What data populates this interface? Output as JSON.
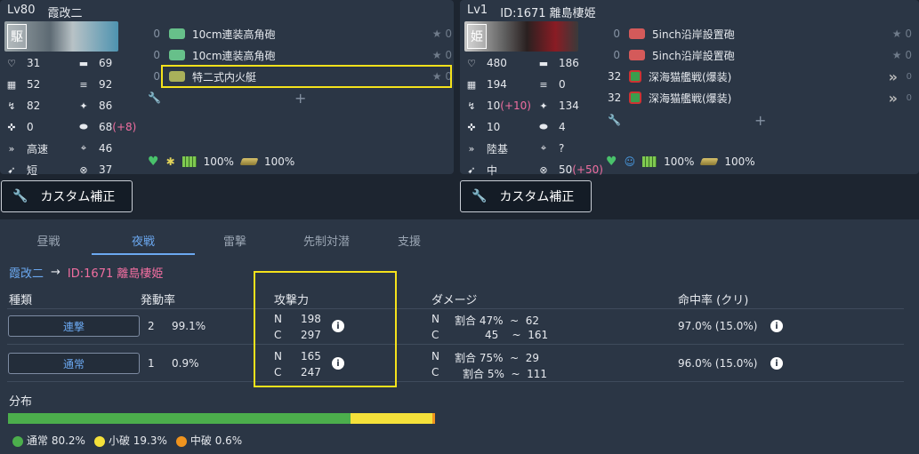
{
  "left_ship": {
    "level": "Lv80",
    "name": "霞改二",
    "banner_tag": "駆",
    "stats": [
      {
        "icon": "hp-icon",
        "glyph": "♡",
        "value": "31"
      },
      {
        "icon": "firepower-icon",
        "glyph": "▬",
        "value": "69"
      },
      {
        "icon": "armor-icon",
        "glyph": "▦",
        "value": "52"
      },
      {
        "icon": "torpedo-icon",
        "glyph": "≡",
        "value": "92"
      },
      {
        "icon": "evasion-icon",
        "glyph": "↯",
        "value": "82"
      },
      {
        "icon": "aa-icon",
        "glyph": "✦",
        "value": "86"
      },
      {
        "icon": "aircraft-icon",
        "glyph": "✜",
        "value": "0"
      },
      {
        "icon": "asw-icon",
        "glyph": "⬬",
        "value": "68",
        "extra": "(+8)"
      },
      {
        "icon": "speed-icon",
        "glyph": "»",
        "value": "高速"
      },
      {
        "icon": "los-icon",
        "glyph": "⌖",
        "value": "46"
      },
      {
        "icon": "range-icon",
        "glyph": "➹",
        "value": "短"
      },
      {
        "icon": "luck-icon",
        "glyph": "⊗",
        "value": "37"
      }
    ],
    "equipment": [
      {
        "count": "0",
        "name": "10cm連装高角砲",
        "star": "★ 0",
        "kind": "green-gun"
      },
      {
        "count": "0",
        "name": "10cm連装高角砲",
        "star": "★ 0",
        "kind": "green-gun"
      },
      {
        "count": "0",
        "name": "特二式内火艇",
        "star": "★ 0",
        "kind": "tank"
      }
    ],
    "morale": "100%",
    "fuel": "100%",
    "ammo": "100%",
    "button": "カスタム補正"
  },
  "right_ship": {
    "level": "Lv1",
    "name": "ID:1671 離島棲姫",
    "banner_tag": "姫",
    "stats": [
      {
        "icon": "hp-icon",
        "glyph": "♡",
        "value": "480"
      },
      {
        "icon": "firepower-icon",
        "glyph": "▬",
        "value": "186"
      },
      {
        "icon": "armor-icon",
        "glyph": "▦",
        "value": "194"
      },
      {
        "icon": "torpedo-icon",
        "glyph": "≡",
        "value": "0"
      },
      {
        "icon": "evasion-icon",
        "glyph": "↯",
        "value": "10",
        "extra": "(+10)"
      },
      {
        "icon": "aa-icon",
        "glyph": "✦",
        "value": "134"
      },
      {
        "icon": "aircraft-icon",
        "glyph": "✜",
        "value": "10"
      },
      {
        "icon": "asw-icon",
        "glyph": "⬬",
        "value": "4"
      },
      {
        "icon": "speed-icon",
        "glyph": "»",
        "value": "陸基"
      },
      {
        "icon": "los-icon",
        "glyph": "⌖",
        "value": "?"
      },
      {
        "icon": "range-icon",
        "glyph": "➹",
        "value": "中"
      },
      {
        "icon": "luck-icon",
        "glyph": "⊗",
        "value": "50",
        "extra": "(+50)"
      }
    ],
    "equipment": [
      {
        "count": "0",
        "name": "5inch沿岸設置砲",
        "star": "★ 0",
        "kind": "red-gun",
        "w": false
      },
      {
        "count": "0",
        "name": "5inch沿岸設置砲",
        "star": "★ 0",
        "kind": "red-gun",
        "w": false
      },
      {
        "count": "32",
        "name": "深海猫艦戦(爆装)",
        "star": "0",
        "kind": "ftr",
        "w": true
      },
      {
        "count": "32",
        "name": "深海猫艦戦(爆装)",
        "star": "0",
        "kind": "ftr",
        "w": true
      }
    ],
    "fuel": "100%",
    "ammo": "100%",
    "button": "カスタム補正"
  },
  "tabs": [
    "昼戦",
    "夜戦",
    "雷撃",
    "先制対潜",
    "支援"
  ],
  "active_tab": 1,
  "crumb": {
    "from": "霞改二",
    "arrow": "→",
    "to": "ID:1671 離島棲姫"
  },
  "headers": {
    "type": "種類",
    "rate": "発動率",
    "power": "攻撃力",
    "damage": "ダメージ",
    "hit": "命中率 (クリ)"
  },
  "rows": [
    {
      "label": "連撃",
      "num": "2",
      "rate": "99.1%",
      "n_power": "198",
      "c_power": "297",
      "n_dmg": "割合 47%  ~  62",
      "c_dmg": "45    ~  161",
      "hit": "97.0% (15.0%)"
    },
    {
      "label": "通常",
      "num": "1",
      "rate": "0.9%",
      "n_power": "165",
      "c_power": "247",
      "n_dmg": "割合 75%  ~  29",
      "c_dmg": "割合 5%  ~  111",
      "hit": "96.0% (15.0%)"
    }
  ],
  "nc": {
    "n": "N",
    "c": "C"
  },
  "distribution": {
    "label": "分布",
    "items": [
      {
        "name": "通常",
        "pct": 80.2,
        "text": "通常 80.2%",
        "color": "#4cae4c"
      },
      {
        "name": "小破",
        "pct": 19.3,
        "text": "小破 19.3%",
        "color": "#f5e13a"
      },
      {
        "name": "中破",
        "pct": 0.6,
        "text": "中破 0.6%",
        "color": "#f0941e"
      }
    ]
  },
  "colors": {
    "accent": "#6ba8f0",
    "pink": "#f06ea0",
    "highlight": "#f5e21b"
  }
}
